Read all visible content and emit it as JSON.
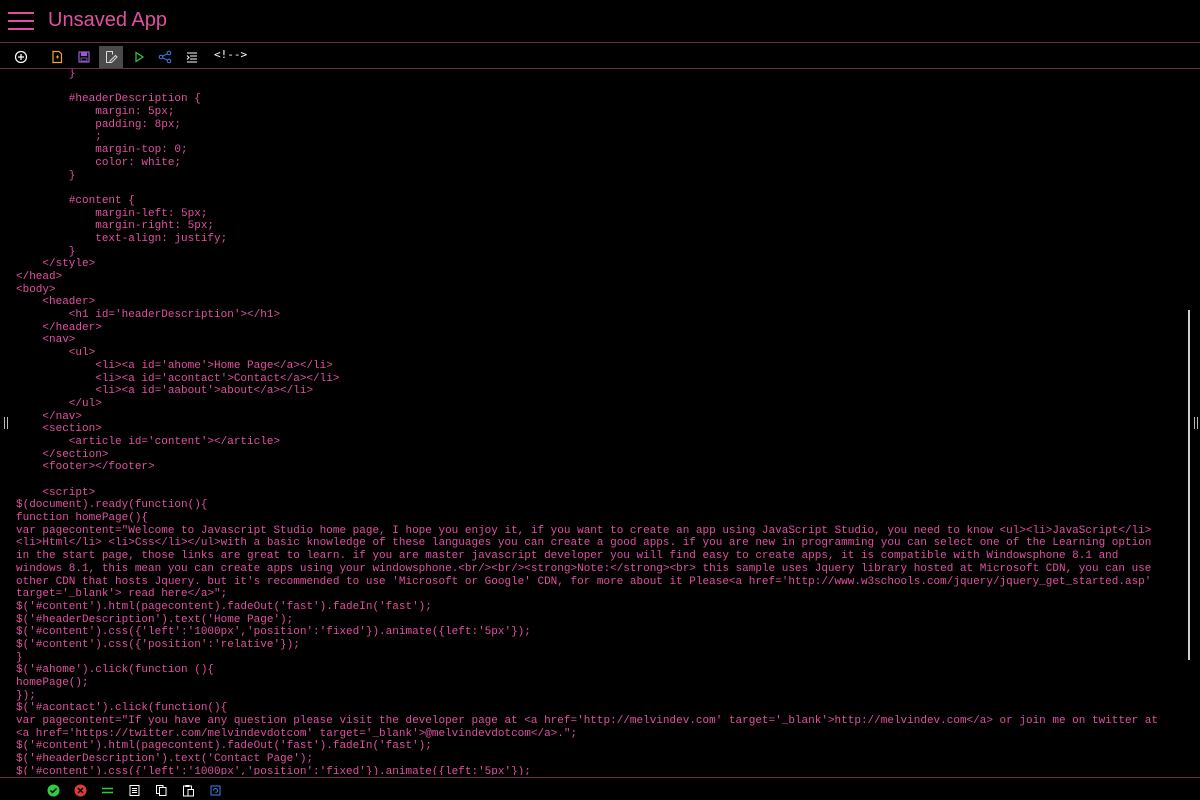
{
  "app": {
    "title": "Unsaved App"
  },
  "toolbar": {
    "comment_label": "<!-->"
  },
  "colors": {
    "accent": "#e0509f",
    "background": "#000000",
    "toolbar_active": "#4a4a4a",
    "status_ok": "#2ecc40",
    "status_error": "#e53935"
  },
  "icons": {
    "toolbar": [
      "add-circle-icon",
      "new-file-icon",
      "save-icon",
      "edit-icon",
      "run-icon",
      "share-icon",
      "format-icon"
    ],
    "statusbar": [
      "check-icon",
      "error-icon",
      "align-icon",
      "select-all-icon",
      "copy-icon",
      "paste-icon",
      "refresh-icon"
    ]
  },
  "editor": {
    "lines": [
      "        }",
      "",
      "        #headerDescription {",
      "            margin: 5px;",
      "            padding: 8px;",
      "            ;",
      "            margin-top: 0;",
      "            color: white;",
      "        }",
      "",
      "        #content {",
      "            margin-left: 5px;",
      "            margin-right: 5px;",
      "            text-align: justify;",
      "        }",
      "    </style>",
      "</head>",
      "<body>",
      "    <header>",
      "        <h1 id='headerDescription'></h1>",
      "    </header>",
      "    <nav>",
      "        <ul>",
      "            <li><a id='ahome'>Home Page</a></li>",
      "            <li><a id='acontact'>Contact</a></li>",
      "            <li><a id='aabout'>about</a></li>",
      "        </ul>",
      "    </nav>",
      "    <section>",
      "        <article id='content'></article>",
      "    </section>",
      "    <footer></footer>",
      "",
      "    <script>",
      "$(document).ready(function(){",
      "function homePage(){",
      "var pagecontent=\"Welcome to Javascript Studio home page, I hope you enjoy it, if you want to create an app using JavaScript Studio, you need to know <ul><li>JavaScript</li>",
      "<li>Html</li> <li>Css</li></ul>with a basic knowledge of these languages you can create a good apps. if you are new in programming you can select one of the Learning option",
      "in the start page, those links are great to learn. if you are master javascript developer you will find easy to create apps, it is compatible with Windowsphone 8.1 and",
      "windows 8.1, this mean you can create apps using your windowsphone.<br/><br/><strong>Note:</strong><br> this sample uses Jquery library hosted at Microsoft CDN, you can use",
      "other CDN that hosts Jquery. but it's recommended to use 'Microsoft or Google' CDN, for more about it Please<a href='http://www.w3schools.com/jquery/jquery_get_started.asp'",
      "target='_blank'> read here</a>\";",
      "$('#content').html(pagecontent).fadeOut('fast').fadeIn('fast');",
      "$('#headerDescription').text('Home Page');",
      "$('#content').css({'left':'1000px','position':'fixed'}).animate({left:'5px'});",
      "$('#content').css({'position':'relative'});",
      "}",
      "$('#ahome').click(function (){",
      "homePage();",
      "});",
      "$('#acontact').click(function(){",
      "var pagecontent=\"If you have any question please visit the developer page at <a href='http://melvindev.com' target='_blank'>http://melvindev.com</a> or join me on twitter at",
      "<a href='https://twitter.com/melvindevdotcom' target='_blank'>@melvindevdotcom</a>.\";",
      "$('#content').html(pagecontent).fadeOut('fast').fadeIn('fast');",
      "$('#headerDescription').text('Contact Page');",
      "$('#content').css({'left':'1000px','position':'fixed'}).animate({left:'5px'});"
    ]
  }
}
